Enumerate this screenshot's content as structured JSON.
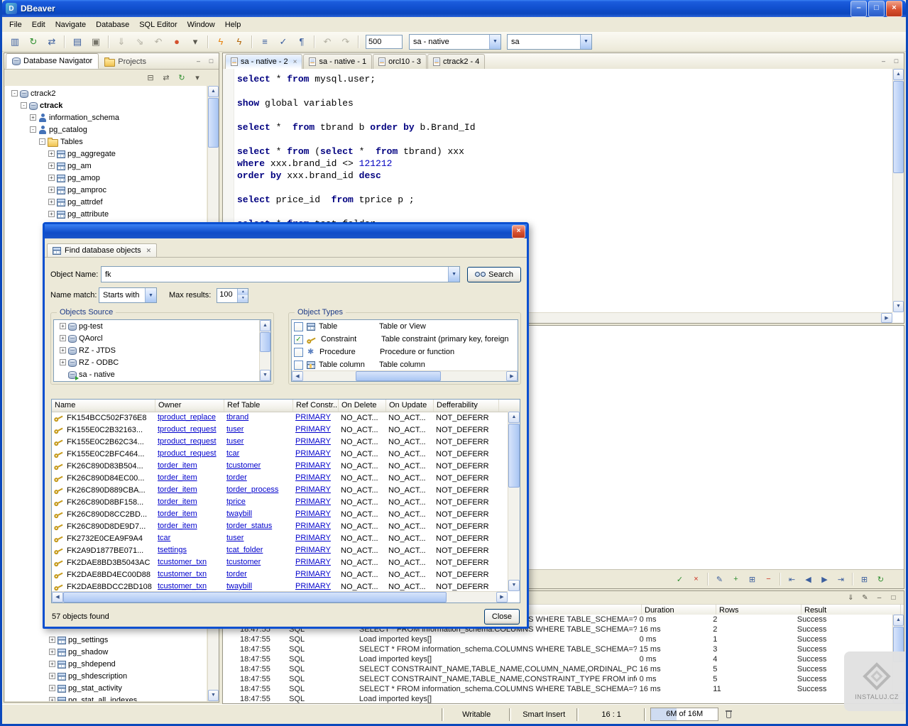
{
  "colors": {
    "titlebar": "#1455d6",
    "dialog_border": "#0b50d0",
    "link": "#0000cc",
    "sql_keyword": "#000080",
    "sql_number": "#0000c0",
    "execute_accent": "#e8820c"
  },
  "titlebar": {
    "title": "DBeaver"
  },
  "menubar": {
    "items": [
      "File",
      "Edit",
      "Navigate",
      "Database",
      "SQL Editor",
      "Window",
      "Help"
    ]
  },
  "tool<br>": "",
  "toolbar": {
    "fetch_size": "500",
    "connection": "sa - native",
    "schema": "sa",
    "icons": [
      {
        "name": "driver-manager-icon",
        "glyph": "▥",
        "color": "#3b5e9e"
      },
      {
        "name": "reconnect-icon",
        "glyph": "↻",
        "color": "#2f8f2f"
      },
      {
        "name": "transaction-mode-icon",
        "glyph": "⇄",
        "color": "#3b5e9e"
      },
      {
        "sep": true
      },
      {
        "name": "new-sql-editor-icon",
        "glyph": "▤",
        "color": "#3b5e9e"
      },
      {
        "name": "print-icon",
        "glyph": "▣",
        "color": "#76746a"
      },
      {
        "sep": true
      },
      {
        "name": "save-icon",
        "glyph": "⇓",
        "color": "#b3b0a2"
      },
      {
        "name": "save-as-icon",
        "glyph": "⇘",
        "color": "#b3b0a2"
      },
      {
        "name": "revert-icon",
        "glyph": "↶",
        "color": "#b3b0a2"
      },
      {
        "name": "error-marker-icon",
        "glyph": "●",
        "color": "#d4502e"
      },
      {
        "name": "toolbar-menu-icon",
        "glyph": "▾",
        "color": "#5a584e"
      },
      {
        "sep": true
      },
      {
        "name": "execute-statement-icon",
        "glyph": "ϟ",
        "color": "#e8820c"
      },
      {
        "name": "execute-script-icon",
        "glyph": "ϟ",
        "color": "#b36508"
      },
      {
        "sep": true
      },
      {
        "name": "explain-plan-icon",
        "glyph": "≡",
        "color": "#3b5e9e"
      },
      {
        "name": "validate-query-icon",
        "glyph": "✓",
        "color": "#3b5e9e"
      },
      {
        "name": "format-sql-icon",
        "glyph": "¶",
        "color": "#3b5e9e"
      },
      {
        "sep": true
      },
      {
        "name": "undo-icon",
        "glyph": "↶",
        "color": "#b3b0a2"
      },
      {
        "name": "redo-icon",
        "glyph": "↷",
        "color": "#b3b0a2"
      },
      {
        "sep": true
      }
    ]
  },
  "navigator": {
    "tabs": [
      {
        "label": "Database Navigator",
        "active": true
      },
      {
        "label": "Projects",
        "active": false
      }
    ],
    "toolbar_icons": [
      {
        "name": "collapse-all-icon",
        "glyph": "⊟",
        "color": "#5a584e"
      },
      {
        "name": "link-with-editor-icon",
        "glyph": "⇄",
        "color": "#5a584e"
      },
      {
        "name": "refresh-tree-icon",
        "glyph": "↻",
        "color": "#2f8f2f"
      },
      {
        "name": "view-menu-icon",
        "glyph": "▾",
        "color": "#5a584e"
      }
    ],
    "tree_top": [
      {
        "label": "ctrack2",
        "level": 0,
        "exp": "-",
        "icon": "db"
      },
      {
        "label": "ctrack",
        "level": 1,
        "exp": "-",
        "icon": "db",
        "bold": true
      },
      {
        "label": "information_schema",
        "level": 2,
        "exp": "+",
        "icon": "schema"
      },
      {
        "label": "pg_catalog",
        "level": 2,
        "exp": "-",
        "icon": "schema"
      },
      {
        "label": "Tables",
        "level": 3,
        "exp": "-",
        "icon": "folder"
      },
      {
        "label": "pg_aggregate",
        "level": 4,
        "exp": "+",
        "icon": "table"
      },
      {
        "label": "pg_am",
        "level": 4,
        "exp": "+",
        "icon": "table"
      },
      {
        "label": "pg_amop",
        "level": 4,
        "exp": "+",
        "icon": "table"
      },
      {
        "label": "pg_amproc",
        "level": 4,
        "exp": "+",
        "icon": "table"
      },
      {
        "label": "pg_attrdef",
        "level": 4,
        "exp": "+",
        "icon": "table"
      },
      {
        "label": "pg_attribute",
        "level": 4,
        "exp": "+",
        "icon": "table"
      }
    ],
    "tree_bottom": [
      {
        "label": "pg_settings",
        "level": 4,
        "exp": "+",
        "icon": "table"
      },
      {
        "label": "pg_shadow",
        "level": 4,
        "exp": "+",
        "icon": "table"
      },
      {
        "label": "pg_shdepend",
        "level": 4,
        "exp": "+",
        "icon": "table"
      },
      {
        "label": "pg_shdescription",
        "level": 4,
        "exp": "+",
        "icon": "table"
      },
      {
        "label": "pg_stat_activity",
        "level": 4,
        "exp": "+",
        "icon": "table"
      },
      {
        "label": "pg_stat_all_indexes",
        "level": 4,
        "exp": "+",
        "icon": "table"
      }
    ]
  },
  "editor": {
    "tabs": [
      {
        "label": "sa - native - 2",
        "active": true
      },
      {
        "label": "sa - native - 1",
        "active": false
      },
      {
        "label": "orcl10 - 3",
        "active": false
      },
      {
        "label": "ctrack2 - 4",
        "active": false
      }
    ],
    "sql_lines": [
      [
        [
          "k",
          "select"
        ],
        [
          "t",
          " * "
        ],
        [
          "k",
          "from"
        ],
        [
          "t",
          " mysql.user;"
        ]
      ],
      [],
      [
        [
          "k",
          "show"
        ],
        [
          "t",
          " global variables"
        ]
      ],
      [],
      [
        [
          "k",
          "select"
        ],
        [
          "t",
          " *  "
        ],
        [
          "k",
          "from"
        ],
        [
          "t",
          " tbrand b "
        ],
        [
          "k",
          "order"
        ],
        [
          "t",
          " "
        ],
        [
          "k",
          "by"
        ],
        [
          "t",
          " b.Brand_Id"
        ]
      ],
      [],
      [
        [
          "k",
          "select"
        ],
        [
          "t",
          " * "
        ],
        [
          "k",
          "from"
        ],
        [
          "t",
          " ("
        ],
        [
          "k",
          "select"
        ],
        [
          "t",
          " *  "
        ],
        [
          "k",
          "from"
        ],
        [
          "t",
          " tbrand) xxx"
        ]
      ],
      [
        [
          "k",
          "where"
        ],
        [
          "t",
          " xxx.brand_id <> "
        ],
        [
          "n",
          "121212"
        ]
      ],
      [
        [
          "k",
          "order"
        ],
        [
          "t",
          " "
        ],
        [
          "k",
          "by"
        ],
        [
          "t",
          " xxx.brand_id "
        ],
        [
          "k",
          "desc"
        ]
      ],
      [],
      [
        [
          "k",
          "select"
        ],
        [
          "t",
          " price_id  "
        ],
        [
          "k",
          "from"
        ],
        [
          "t",
          " tprice p ;"
        ]
      ],
      [],
      [
        [
          "k",
          "select"
        ],
        [
          "t",
          " * "
        ],
        [
          "k",
          "from"
        ],
        [
          "t",
          " tcat_folder"
        ]
      ]
    ]
  },
  "results": {
    "toolbar_icons": [
      {
        "name": "apply-changes-icon",
        "glyph": "✓",
        "color": "#2f8f2f"
      },
      {
        "name": "reject-changes-icon",
        "glyph": "×",
        "color": "#cc3322"
      },
      {
        "sep": true
      },
      {
        "name": "edit-value-icon",
        "glyph": "✎",
        "color": "#3b5e9e"
      },
      {
        "name": "add-row-icon",
        "glyph": "+",
        "color": "#2f8f2f"
      },
      {
        "name": "copy-row-icon",
        "glyph": "⊞",
        "color": "#3b5e9e"
      },
      {
        "name": "delete-row-icon",
        "glyph": "−",
        "color": "#cc3322"
      },
      {
        "sep": true
      },
      {
        "name": "first-row-icon",
        "glyph": "⇤",
        "color": "#3b5e9e"
      },
      {
        "name": "previous-row-icon",
        "glyph": "◀",
        "color": "#3b5e9e"
      },
      {
        "name": "next-row-icon",
        "glyph": "▶",
        "color": "#3b5e9e"
      },
      {
        "name": "last-row-icon",
        "glyph": "⇥",
        "color": "#3b5e9e"
      },
      {
        "sep": true
      },
      {
        "name": "grid-view-icon",
        "glyph": "⊞",
        "color": "#3b5e9e"
      },
      {
        "name": "refresh-results-icon",
        "glyph": "↻",
        "color": "#2f8f2f"
      }
    ]
  },
  "log": {
    "toolbar_icons": [
      {
        "name": "log-export-icon",
        "glyph": "⇓",
        "color": "#55534a"
      },
      {
        "name": "log-filter-icon",
        "glyph": "✎",
        "color": "#55534a"
      },
      {
        "name": "minimize-view-icon",
        "glyph": "–",
        "color": "#55534a"
      },
      {
        "name": "maximize-view-icon",
        "glyph": "□",
        "color": "#55534a"
      }
    ],
    "columns": [
      "",
      "",
      "",
      "Duration",
      "Rows",
      "Result"
    ],
    "rows": [
      {
        "time": "18:47:55",
        "type": "SQL",
        "text": "SELECT * FROM information_schema.COLUMNS WHERE TABLE_SCHEMA=? A...",
        "duration": "0 ms",
        "rows": "2",
        "result": "Success"
      },
      {
        "time": "18:47:55",
        "type": "SQL",
        "text": "SELECT * FROM information_schema.COLUMNS WHERE TABLE_SCHEMA=? A...",
        "duration": "16 ms",
        "rows": "2",
        "result": "Success"
      },
      {
        "time": "18:47:55",
        "type": "SQL",
        "text": "Load imported keys[]",
        "duration": "0 ms",
        "rows": "1",
        "result": "Success"
      },
      {
        "time": "18:47:55",
        "type": "SQL",
        "text": "SELECT * FROM information_schema.COLUMNS WHERE TABLE_SCHEMA=? A...",
        "duration": "15 ms",
        "rows": "3",
        "result": "Success"
      },
      {
        "time": "18:47:55",
        "type": "SQL",
        "text": "Load imported keys[]",
        "duration": "0 ms",
        "rows": "4",
        "result": "Success"
      },
      {
        "time": "18:47:55",
        "type": "SQL",
        "text": "SELECT CONSTRAINT_NAME,TABLE_NAME,COLUMN_NAME,ORDINAL_POSITI...",
        "duration": "16 ms",
        "rows": "5",
        "result": "Success"
      },
      {
        "time": "18:47:55",
        "type": "SQL",
        "text": "SELECT CONSTRAINT_NAME,TABLE_NAME,CONSTRAINT_TYPE FROM informa...",
        "duration": "0 ms",
        "rows": "5",
        "result": "Success"
      },
      {
        "time": "18:47:55",
        "type": "SQL",
        "text": "SELECT * FROM information_schema.COLUMNS WHERE TABLE_SCHEMA=? A...",
        "duration": "16 ms",
        "rows": "11",
        "result": "Success"
      },
      {
        "time": "18:47:55",
        "type": "SQL",
        "text": "Load imported keys[]",
        "duration": "",
        "rows": "",
        "result": ""
      }
    ]
  },
  "statusbar": {
    "writable": "Writable",
    "insert_mode": "Smart Insert",
    "position": "16 : 1",
    "heap": "6M of 16M"
  },
  "dialog": {
    "tab_label": "Find database objects",
    "object_name_label": "Object Name:",
    "object_name_value": "fk",
    "search_label": "Search",
    "name_match_label": "Name match:",
    "name_match_value": "Starts with",
    "max_results_label": "Max results:",
    "max_results_value": "100",
    "sources_title": "Objects Source",
    "types_title": "Object Types",
    "sources": [
      {
        "label": "pg-test",
        "exp": "+"
      },
      {
        "label": "QAorcl",
        "exp": "+"
      },
      {
        "label": "RZ - JTDS",
        "exp": "+"
      },
      {
        "label": "RZ - ODBC",
        "exp": "+"
      },
      {
        "label": "sa - native",
        "connected": true
      }
    ],
    "types": [
      {
        "checked": false,
        "icon": "table",
        "label": "Table",
        "desc": "Table or View"
      },
      {
        "checked": true,
        "icon": "constraint",
        "label": "Constraint",
        "desc": "Table constraint (primary key, foreign"
      },
      {
        "checked": false,
        "icon": "procedure",
        "label": "Procedure",
        "desc": "Procedure or function"
      },
      {
        "checked": false,
        "icon": "column",
        "label": "Table column",
        "desc": "Table column"
      }
    ],
    "columns": [
      "Name",
      "Owner",
      "Ref Table",
      "Ref Constr...",
      "On Delete",
      "On Update",
      "Defferability"
    ],
    "rows": [
      [
        "FK154BCC502F376E8",
        "tproduct_replace",
        "tbrand",
        "PRIMARY",
        "NO_ACT...",
        "NO_ACT...",
        "NOT_DEFERR"
      ],
      [
        "FK155E0C2B32163...",
        "tproduct_request",
        "tuser",
        "PRIMARY",
        "NO_ACT...",
        "NO_ACT...",
        "NOT_DEFERR"
      ],
      [
        "FK155E0C2B62C34...",
        "tproduct_request",
        "tuser",
        "PRIMARY",
        "NO_ACT...",
        "NO_ACT...",
        "NOT_DEFERR"
      ],
      [
        "FK155E0C2BFC464...",
        "tproduct_request",
        "tcar",
        "PRIMARY",
        "NO_ACT...",
        "NO_ACT...",
        "NOT_DEFERR"
      ],
      [
        "FK26C890D83B504...",
        "torder_item",
        "tcustomer",
        "PRIMARY",
        "NO_ACT...",
        "NO_ACT...",
        "NOT_DEFERR"
      ],
      [
        "FK26C890D84EC00...",
        "torder_item",
        "torder",
        "PRIMARY",
        "NO_ACT...",
        "NO_ACT...",
        "NOT_DEFERR"
      ],
      [
        "FK26C890D889CBA...",
        "torder_item",
        "torder_process",
        "PRIMARY",
        "NO_ACT...",
        "NO_ACT...",
        "NOT_DEFERR"
      ],
      [
        "FK26C890D8BF158...",
        "torder_item",
        "tprice",
        "PRIMARY",
        "NO_ACT...",
        "NO_ACT...",
        "NOT_DEFERR"
      ],
      [
        "FK26C890D8CC2BD...",
        "torder_item",
        "twaybill",
        "PRIMARY",
        "NO_ACT...",
        "NO_ACT...",
        "NOT_DEFERR"
      ],
      [
        "FK26C890D8DE9D7...",
        "torder_item",
        "torder_status",
        "PRIMARY",
        "NO_ACT...",
        "NO_ACT...",
        "NOT_DEFERR"
      ],
      [
        "FK2732E0CEA9F9A4",
        "tcar",
        "tuser",
        "PRIMARY",
        "NO_ACT...",
        "NO_ACT...",
        "NOT_DEFERR"
      ],
      [
        "FK2A9D1877BE071...",
        "tsettings",
        "tcat_folder",
        "PRIMARY",
        "NO_ACT...",
        "NO_ACT...",
        "NOT_DEFERR"
      ],
      [
        "FK2DAE8BD3B5043AC",
        "tcustomer_txn",
        "tcustomer",
        "PRIMARY",
        "NO_ACT...",
        "NO_ACT...",
        "NOT_DEFERR"
      ],
      [
        "FK2DAE8BD4EC00D88",
        "tcustomer_txn",
        "torder",
        "PRIMARY",
        "NO_ACT...",
        "NO_ACT...",
        "NOT_DEFERR"
      ],
      [
        "FK2DAE8BDCC2BD108",
        "tcustomer_txn",
        "twaybill",
        "PRIMARY",
        "NO_ACT...",
        "NO_ACT...",
        "NOT_DEFERR"
      ]
    ],
    "status": "57 objects found",
    "close_label": "Close"
  },
  "watermark": {
    "text": "INSTALUJ.CZ"
  }
}
